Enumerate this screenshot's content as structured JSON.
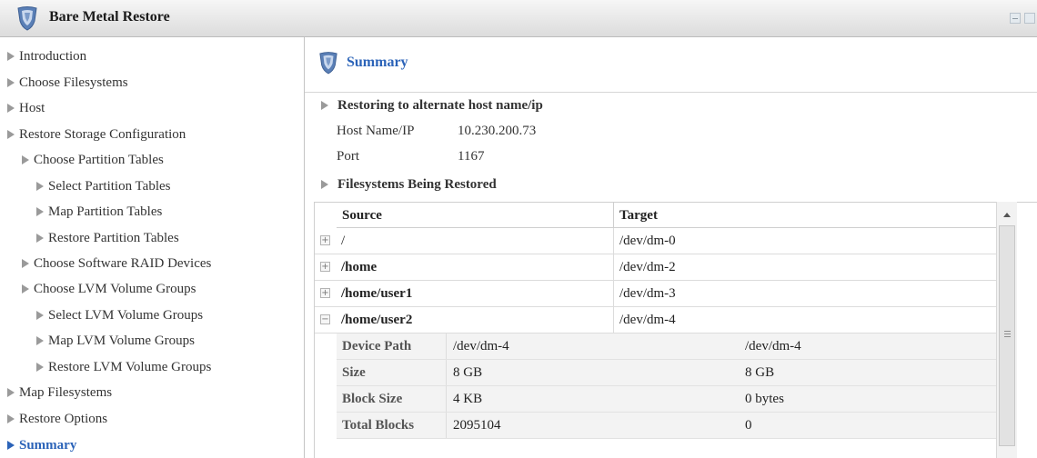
{
  "window": {
    "title": "Bare Metal Restore",
    "title_icon": "shield-icon",
    "controls": [
      "minimize-icon",
      "close-icon"
    ]
  },
  "nav": {
    "items": [
      {
        "label": "Introduction",
        "level": 0
      },
      {
        "label": "Choose Filesystems",
        "level": 0
      },
      {
        "label": "Host",
        "level": 0
      },
      {
        "label": "Restore Storage Configuration",
        "level": 0
      },
      {
        "label": "Choose Partition Tables",
        "level": 1
      },
      {
        "label": "Select Partition Tables",
        "level": 2
      },
      {
        "label": "Map Partition Tables",
        "level": 2
      },
      {
        "label": "Restore Partition Tables",
        "level": 2
      },
      {
        "label": "Choose Software RAID Devices",
        "level": 1
      },
      {
        "label": "Choose LVM Volume Groups",
        "level": 1
      },
      {
        "label": "Select LVM Volume Groups",
        "level": 2
      },
      {
        "label": "Map LVM Volume Groups",
        "level": 2
      },
      {
        "label": "Restore LVM Volume Groups",
        "level": 2
      },
      {
        "label": "Map Filesystems",
        "level": 0
      },
      {
        "label": "Restore Options",
        "level": 0
      },
      {
        "label": "Summary",
        "level": 0,
        "active": true
      }
    ],
    "active_color": "#2b63b8"
  },
  "main": {
    "header_title": "Summary",
    "host_section": {
      "title": "Restoring to alternate host name/ip",
      "host_label": "Host Name/IP",
      "host_value": "10.230.200.73",
      "port_label": "Port",
      "port_value": "1167"
    },
    "fs_section": {
      "title": "Filesystems Being Restored",
      "columns": {
        "source": "Source",
        "target": "Target"
      },
      "rows": [
        {
          "source": "/",
          "target": "/dev/dm-0",
          "expanded": false
        },
        {
          "source": "/home",
          "target": "/dev/dm-2",
          "expanded": false
        },
        {
          "source": "/home/user1",
          "target": "/dev/dm-3",
          "expanded": false
        },
        {
          "source": "/home/user2",
          "target": "/dev/dm-4",
          "expanded": true
        }
      ],
      "details": [
        {
          "label": "Device Path",
          "value": "/dev/dm-4",
          "target_value": "/dev/dm-4"
        },
        {
          "label": "Size",
          "value": "8 GB",
          "target_value": "8 GB"
        },
        {
          "label": "Block Size",
          "value": "4 KB",
          "target_value": "0 bytes"
        },
        {
          "label": "Total Blocks",
          "value": "2095104",
          "target_value": "0"
        }
      ]
    }
  }
}
